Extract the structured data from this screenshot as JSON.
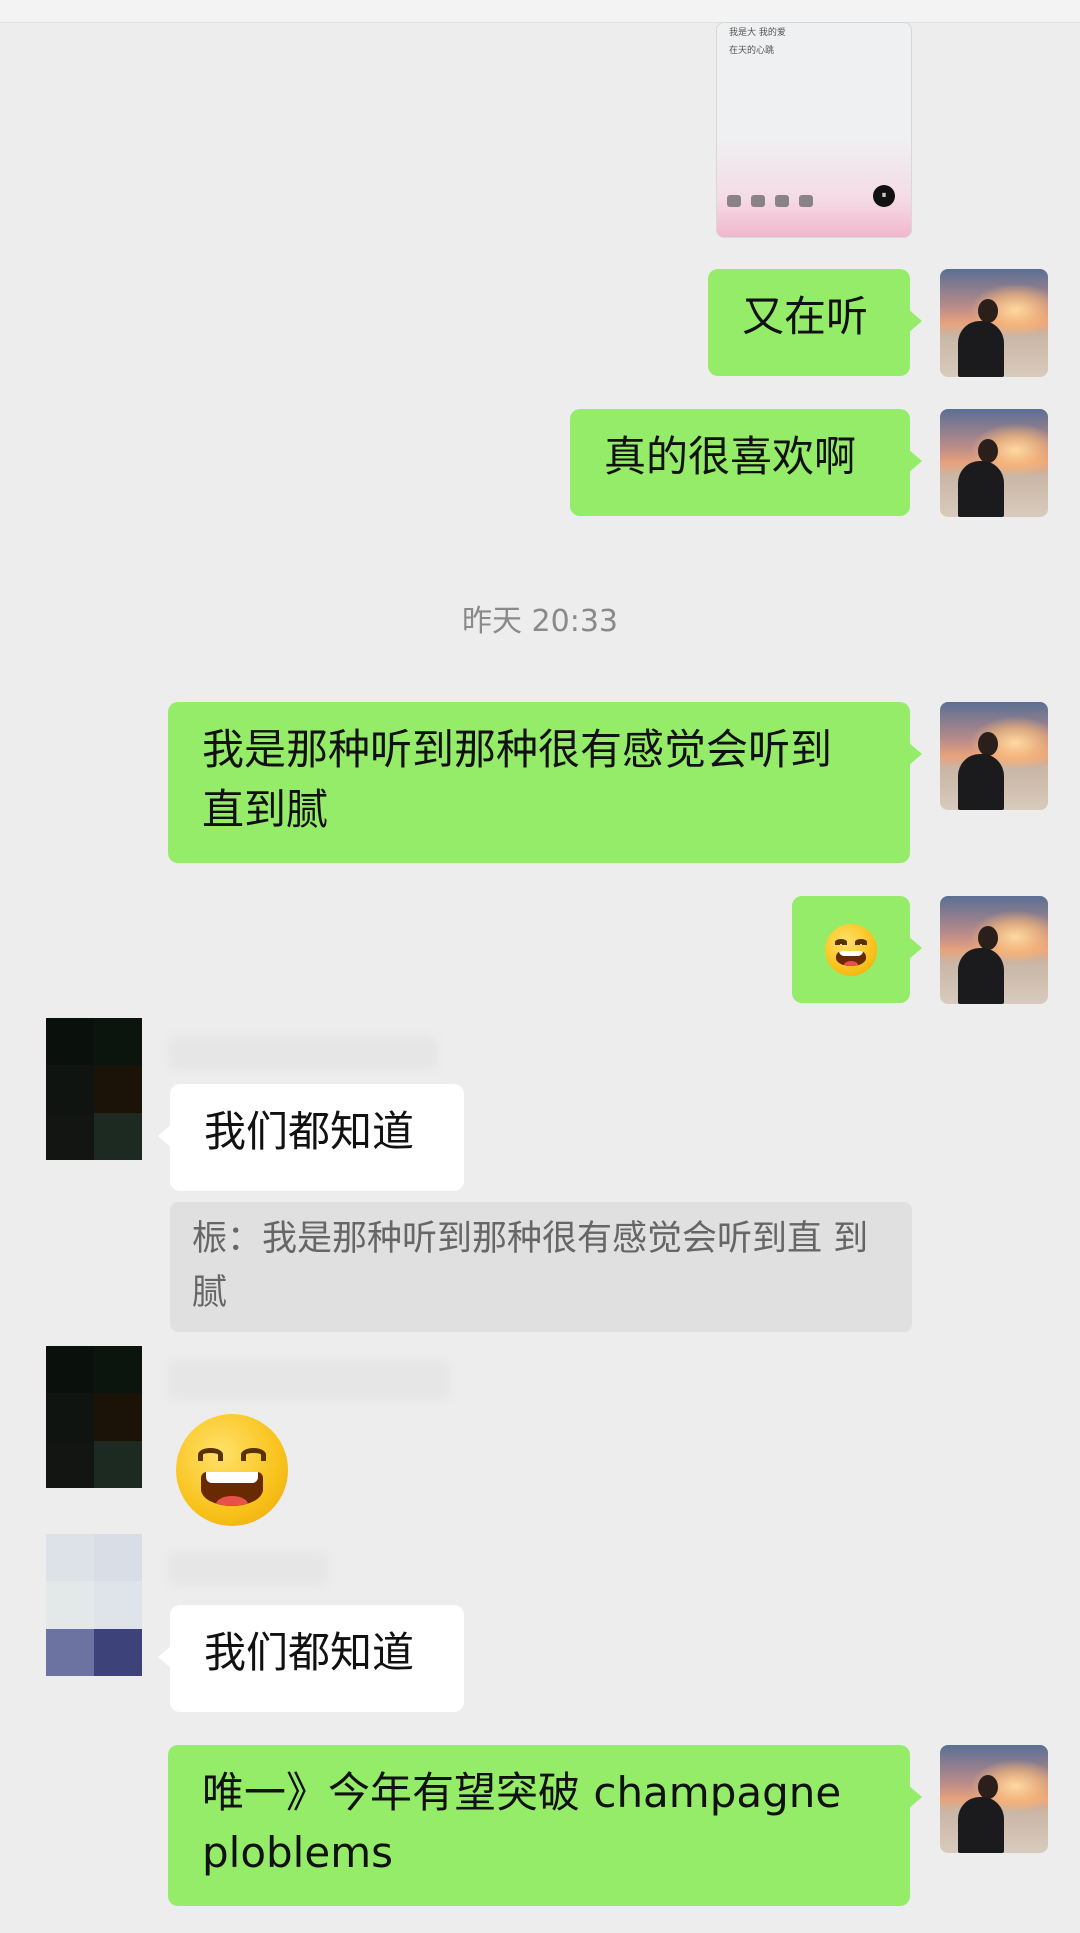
{
  "screenshot_message": {
    "line1": "我是大 我的爱",
    "line2": "在天的心跳"
  },
  "timestamp": "昨天 20:33",
  "messages": {
    "m1": "又在听",
    "m2": "真的很喜欢啊",
    "m3": "我是那种听到那种很有感觉会听到\n直到腻",
    "m5": "我们都知道",
    "quote": "桭：我是那种听到那种很有感觉会听到直\n到腻",
    "m7": "我们都知道",
    "m8": "唯一》今年有望突破 champagne\nploblems"
  },
  "icons": {
    "emoji_grin": "grinning-face-emoji",
    "pause": "⏸"
  },
  "colors": {
    "background": "#ededed",
    "outgoing_bubble": "#95ec69",
    "incoming_bubble": "#ffffff",
    "quote_bg": "#e0e0e0",
    "timestamp": "#8a8a8a"
  }
}
